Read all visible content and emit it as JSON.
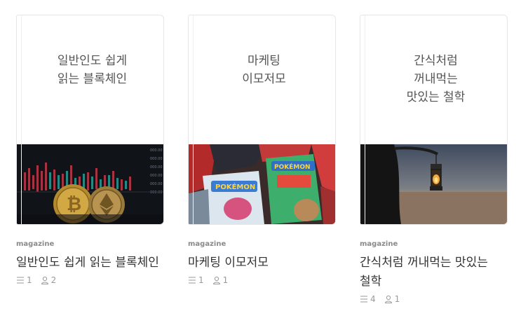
{
  "cards": [
    {
      "cover_title": "일반인도 쉽게 읽는 블록체인",
      "badge": "magazine",
      "title": "일반인도 쉽게 읽는 블록체인",
      "articles": "1",
      "subscribers": "2",
      "image": "crypto-coins-photo"
    },
    {
      "cover_title": "마케팅 이모저모",
      "badge": "magazine",
      "title": "마케팅 이모저모",
      "articles": "1",
      "subscribers": "1",
      "image": "snack-packages-photo"
    },
    {
      "cover_title": "간식처럼 꺼내먹는 맛있는 철학",
      "badge": "magazine",
      "title": "간식처럼 꺼내먹는 맛있는 철학",
      "articles": "4",
      "subscribers": "1",
      "image": "desert-lantern-photo"
    }
  ],
  "icons": {
    "articles": "list-icon",
    "subscribers": "person-icon"
  }
}
